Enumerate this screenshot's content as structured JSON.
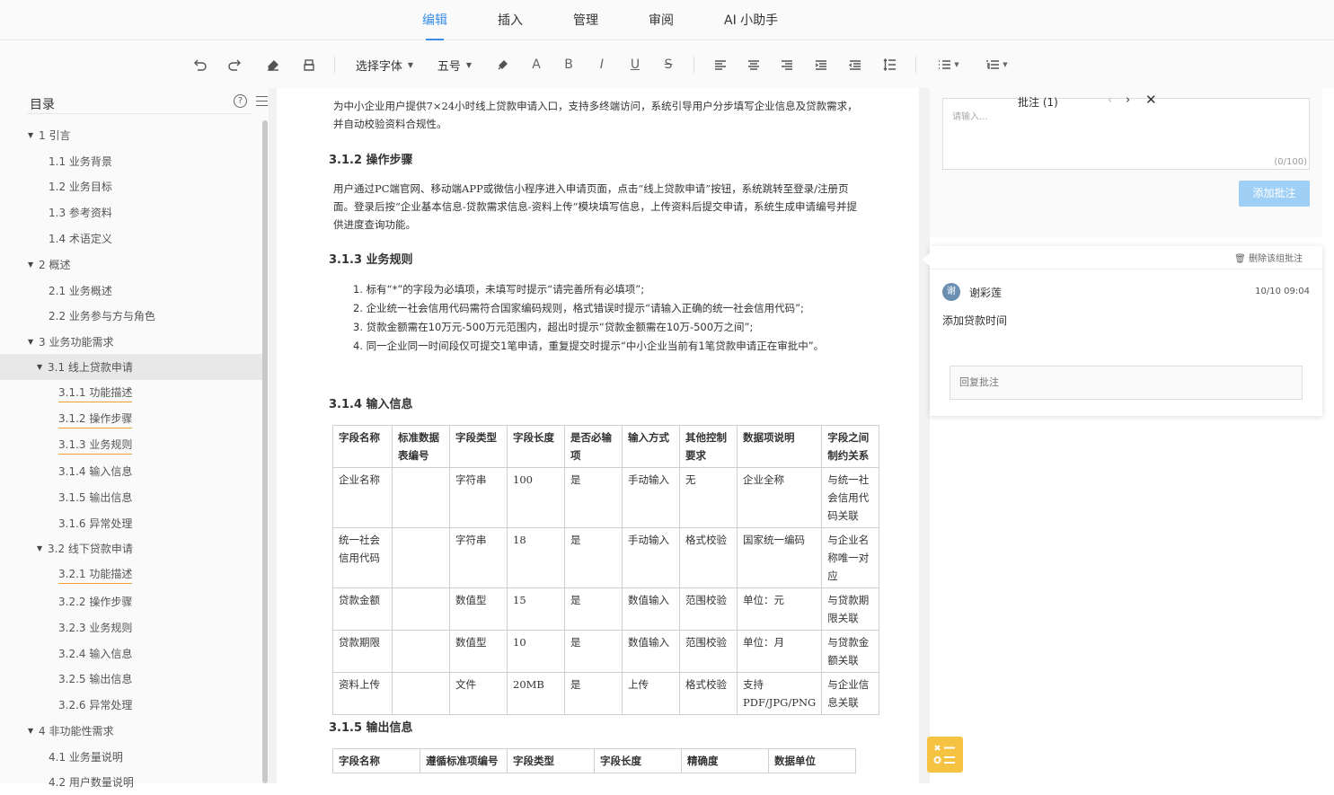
{
  "tabs": [
    "编辑",
    "插入",
    "管理",
    "审阅",
    "AI 小助手"
  ],
  "toolbar": {
    "font_select": "选择字体",
    "size_select": "五号",
    "text_a": "A",
    "bold": "B",
    "italic": "I",
    "underline": "U",
    "strike": "S"
  },
  "sidebar": {
    "title": "目录",
    "help": "?",
    "items": [
      {
        "label": "1 引言",
        "arrow": "▼"
      },
      {
        "label": "1.1 业务背景",
        "arrow": ""
      },
      {
        "label": "1.2 业务目标",
        "arrow": ""
      },
      {
        "label": "1.3 参考资料",
        "arrow": ""
      },
      {
        "label": "1.4 术语定义",
        "arrow": ""
      },
      {
        "label": "2 概述",
        "arrow": "▼"
      },
      {
        "label": "2.1 业务概述",
        "arrow": ""
      },
      {
        "label": "2.2 业务参与方与角色",
        "arrow": ""
      },
      {
        "label": "3 业务功能需求",
        "arrow": "▼"
      },
      {
        "label": "3.1 线上贷款申请",
        "arrow": "▼"
      },
      {
        "label": "3.1.1 功能描述",
        "arrow": ""
      },
      {
        "label": "3.1.2 操作步骤",
        "arrow": ""
      },
      {
        "label": "3.1.3 业务规则",
        "arrow": ""
      },
      {
        "label": "3.1.4 输入信息",
        "arrow": ""
      },
      {
        "label": "3.1.5 输出信息",
        "arrow": ""
      },
      {
        "label": "3.1.6 异常处理",
        "arrow": ""
      },
      {
        "label": "3.2 线下贷款申请",
        "arrow": "▼"
      },
      {
        "label": "3.2.1 功能描述",
        "arrow": ""
      },
      {
        "label": "3.2.2 操作步骤",
        "arrow": ""
      },
      {
        "label": "3.2.3 业务规则",
        "arrow": ""
      },
      {
        "label": "3.2.4 输入信息",
        "arrow": ""
      },
      {
        "label": "3.2.5 输出信息",
        "arrow": ""
      },
      {
        "label": "3.2.6 异常处理",
        "arrow": ""
      },
      {
        "label": "4 非功能性需求",
        "arrow": "▼"
      },
      {
        "label": "4.1 业务量说明",
        "arrow": ""
      },
      {
        "label": "4.2 用户数量说明",
        "arrow": ""
      }
    ]
  },
  "doc": {
    "intro": "为中小企业用户提供7×24小时线上贷款申请入口，支持多终端访问，系统引导用户分步填写企业信息及贷款需求，并自动校验资料合规性。",
    "h_steps": "3.1.2 操作步骤",
    "steps": "用户通过PC端官网、移动端APP或微信小程序进入申请页面，点击“线上贷款申请”按钮，系统跳转至登录/注册页面。登录后按“企业基本信息-贷款需求信息-资料上传”模块填写信息，上传资料后提交申请，系统生成申请编号并提供进度查询功能。",
    "h_rules": "3.1.3 业务规则",
    "rules": [
      "1. 标有“*”的字段为必填项，未填写时提示“请完善所有必填项”;",
      "2. 企业统一社会信用代码需符合国家编码规则，格式错误时提示“请输入正确的统一社会信用代码”;",
      "3. 贷款金额需在10万元-500万元范围内，超出时提示“贷款金额需在10万-500万之间”;",
      "4. 同一企业同一时间段仅可提交1笔申请，重复提交时提示“中小企业当前有1笔贷款申请正在审批中”。"
    ],
    "h_input": "3.1.4 输入信息",
    "input_headers": [
      "字段名称",
      "标准数据表编号",
      "字段类型",
      "字段长度",
      "是否必输项",
      "输入方式",
      "其他控制要求",
      "数据项说明",
      "字段之间制约关系"
    ],
    "input_rows": [
      [
        "企业名称",
        "",
        "字符串",
        "100",
        "是",
        "手动输入",
        "无",
        "企业全称",
        "与统一社会信用代码关联"
      ],
      [
        "统一社会信用代码",
        "",
        "字符串",
        "18",
        "是",
        "手动输入",
        "格式校验",
        "国家统一编码",
        "与企业名称唯一对应"
      ],
      [
        "贷款金额",
        "",
        "数值型",
        "15",
        "是",
        "数值输入",
        "范围校验",
        "单位：元",
        "与贷款期限关联"
      ],
      [
        "贷款期限",
        "",
        "数值型",
        "10",
        "是",
        "数值输入",
        "范围校验",
        "单位：月",
        "与贷款金额关联"
      ],
      [
        "资料上传",
        "",
        "文件",
        "20MB",
        "是",
        "上传",
        "格式校验",
        "支持PDF/JPG/PNG",
        "与企业信息关联"
      ]
    ],
    "h_output": "3.1.5 输出信息",
    "output_headers": [
      "字段名称",
      "遵循标准项编号",
      "字段类型",
      "字段长度",
      "精确度",
      "数据单位"
    ]
  },
  "comment_panel": {
    "title": "批注 (1)",
    "prev": "‹",
    "next": "›",
    "close": "✕",
    "placeholder": "请输入...",
    "counter": "(0/100)",
    "add_button": "添加批注"
  },
  "comment": {
    "delete": "删除该组批注",
    "avatar": "谢",
    "user": "谢彩莲",
    "time": "10/10 09:04",
    "text": "添加贷款时间",
    "reply_placeholder": "回复批注"
  },
  "colors": {
    "accent": "#3a8ee6",
    "add_button": "#a0cff5",
    "fab": "#f5c242",
    "toc_underline": "#f0a030"
  }
}
